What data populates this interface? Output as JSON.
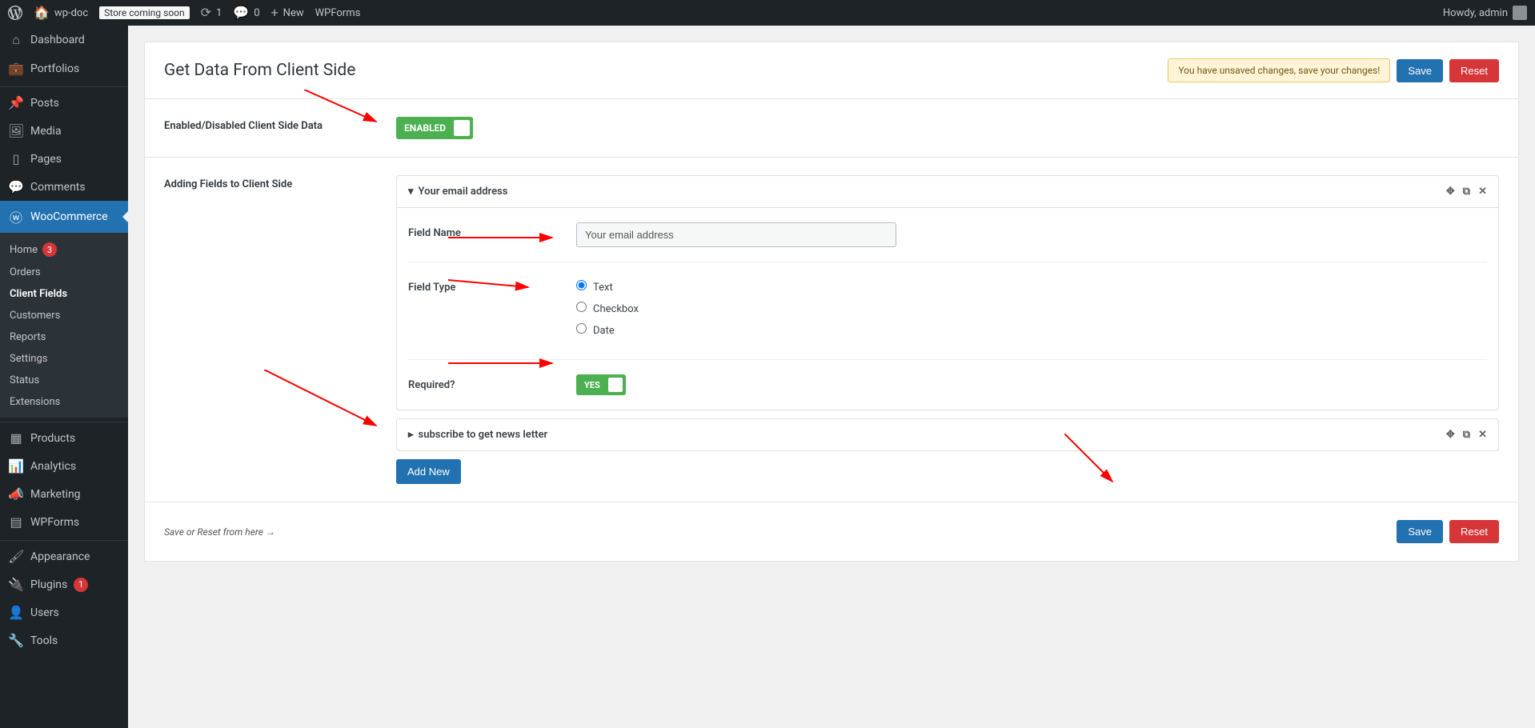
{
  "adminbar": {
    "site_name": "wp-doc",
    "store_badge": "Store coming soon",
    "updates_count": "1",
    "comments_count": "0",
    "new_label": "New",
    "wpforms_label": "WPForms",
    "howdy": "Howdy, admin"
  },
  "sidebar": {
    "dashboard": "Dashboard",
    "portfolios": "Portfolios",
    "posts": "Posts",
    "media": "Media",
    "pages": "Pages",
    "comments": "Comments",
    "woocommerce": "WooCommerce",
    "woo_sub": {
      "home": "Home",
      "home_count": "3",
      "orders": "Orders",
      "client_fields": "Client Fields",
      "customers": "Customers",
      "reports": "Reports",
      "settings": "Settings",
      "status": "Status",
      "extensions": "Extensions"
    },
    "products": "Products",
    "analytics": "Analytics",
    "marketing": "Marketing",
    "wpforms": "WPForms",
    "appearance": "Appearance",
    "plugins": "Plugins",
    "plugins_count": "1",
    "users": "Users",
    "tools": "Tools"
  },
  "page": {
    "title": "Get Data From Client Side",
    "unsaved_notice": "You have unsaved changes, save your changes!",
    "save": "Save",
    "reset": "Reset",
    "enabled_label": "Enabled/Disabled Client Side Data",
    "enabled_toggle": "ENABLED",
    "adding_fields_label": "Adding Fields to Client Side",
    "expanded_panel": {
      "title": "Your email address",
      "field_name_label": "Field Name",
      "field_name_value": "Your email address",
      "field_type_label": "Field Type",
      "opt_text": "Text",
      "opt_checkbox": "Checkbox",
      "opt_date": "Date",
      "required_label": "Required?",
      "required_toggle": "YES"
    },
    "collapsed_panel": {
      "title": "subscribe to get news letter"
    },
    "add_new": "Add New",
    "footer_hint": "Save or Reset from here →"
  }
}
